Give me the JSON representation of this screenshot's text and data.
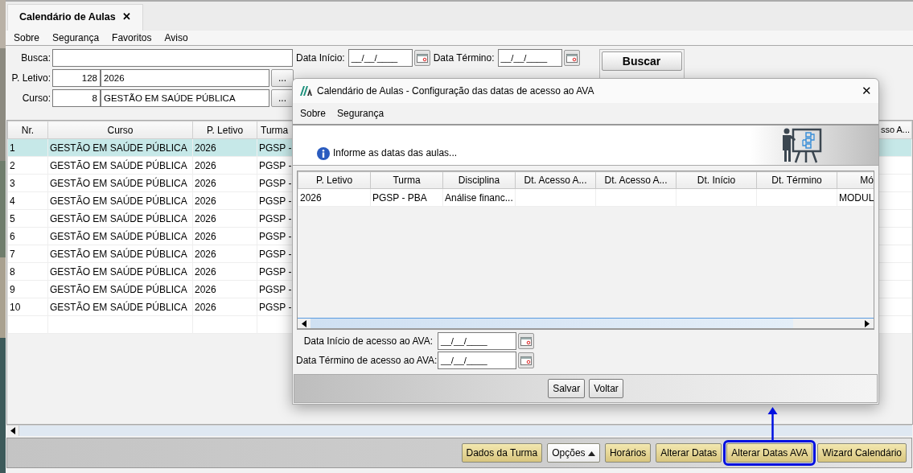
{
  "tab": {
    "title": "Calendário de Aulas",
    "close": "✕"
  },
  "menu": [
    "Sobre",
    "Segurança",
    "Favoritos",
    "Aviso"
  ],
  "filters": {
    "busca_label": "Busca:",
    "data_inicio_label": "Data Início:",
    "data_inicio": "__/__/____",
    "data_termino_label": "Data Término:",
    "data_termino": "__/__/____",
    "search_button": "Buscar",
    "letivo_label": "P. Letivo:",
    "letivo_code": "128",
    "letivo_value": "2026",
    "curso_label": "Curso:",
    "curso_code": "8",
    "curso_value": "GESTÃO EM SAÚDE PÚBLICA",
    "browse": "..."
  },
  "table": {
    "columns": [
      "Nr.",
      "Curso",
      "P. Letivo",
      "Turma"
    ],
    "last_column": "sso A...",
    "rows": [
      {
        "cells": [
          "1",
          "GESTÃO EM SAÚDE PÚBLICA",
          "2026",
          "PGSP -"
        ],
        "selected": true
      },
      {
        "cells": [
          "2",
          "GESTÃO EM SAÚDE PÚBLICA",
          "2026",
          "PGSP -"
        ],
        "selected": false
      },
      {
        "cells": [
          "3",
          "GESTÃO EM SAÚDE PÚBLICA",
          "2026",
          "PGSP -"
        ],
        "selected": false
      },
      {
        "cells": [
          "4",
          "GESTÃO EM SAÚDE PÚBLICA",
          "2026",
          "PGSP -"
        ],
        "selected": false
      },
      {
        "cells": [
          "5",
          "GESTÃO EM SAÚDE PÚBLICA",
          "2026",
          "PGSP -"
        ],
        "selected": false
      },
      {
        "cells": [
          "6",
          "GESTÃO EM SAÚDE PÚBLICA",
          "2026",
          "PGSP -"
        ],
        "selected": false
      },
      {
        "cells": [
          "7",
          "GESTÃO EM SAÚDE PÚBLICA",
          "2026",
          "PGSP -"
        ],
        "selected": false
      },
      {
        "cells": [
          "8",
          "GESTÃO EM SAÚDE PÚBLICA",
          "2026",
          "PGSP -"
        ],
        "selected": false
      },
      {
        "cells": [
          "9",
          "GESTÃO EM SAÚDE PÚBLICA",
          "2026",
          "PGSP -"
        ],
        "selected": false
      },
      {
        "cells": [
          "10",
          "GESTÃO EM SAÚDE PÚBLICA",
          "2026",
          "PGSP -"
        ],
        "selected": false
      }
    ]
  },
  "bottom_buttons": [
    {
      "label": "Dados da Turma",
      "kind": "action",
      "highlighted": false
    },
    {
      "label": "Opções",
      "kind": "dropdown",
      "highlighted": false
    },
    {
      "label": "Horários",
      "kind": "action",
      "highlighted": false
    },
    {
      "label": "Alterar Datas",
      "kind": "action",
      "highlighted": false
    },
    {
      "label": "Alterar Datas AVA",
      "kind": "action",
      "highlighted": true
    },
    {
      "label": "Wizard Calendário",
      "kind": "action",
      "highlighted": false
    }
  ],
  "dialog": {
    "title": "Calendário de Aulas - Configuração das datas de acesso ao AVA",
    "close": "✕",
    "menu": [
      "Sobre",
      "Segurança"
    ],
    "info": "Informe as datas das aulas...",
    "columns": [
      "P. Letivo",
      "Turma",
      "Disciplina",
      "Dt. Acesso A...",
      "Dt. Acesso A...",
      "Dt. Início",
      "Dt. Término",
      "Mó"
    ],
    "rows": [
      {
        "cells": [
          "2026",
          "PGSP - PBA",
          "Análise financ...",
          null,
          null,
          null,
          null,
          "MODUL"
        ]
      }
    ],
    "fields": [
      {
        "label": "Data Início de acesso ao AVA:",
        "value": "__/__/____"
      },
      {
        "label": "Data Término de acesso ao AVA:",
        "value": "__/__/____"
      }
    ],
    "buttons": [
      "Salvar",
      "Voltar"
    ]
  }
}
